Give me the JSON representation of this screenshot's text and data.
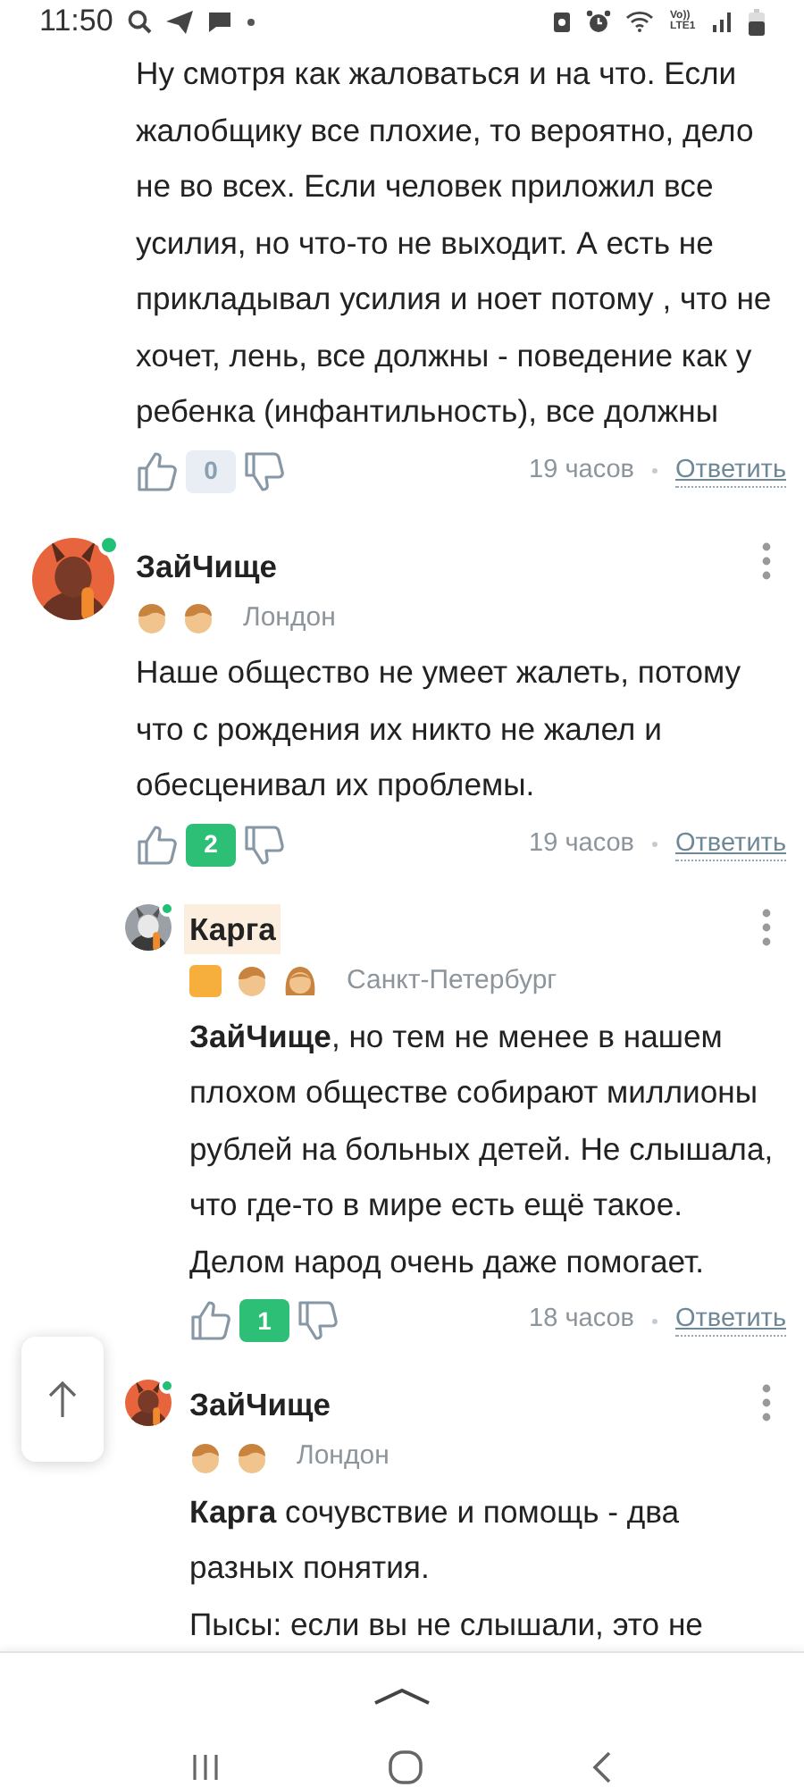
{
  "status_bar": {
    "time": "11:50",
    "network_label": "Vo)) LTE1"
  },
  "comments": [
    {
      "paragraphs": [
        "Ну смотря как жаловаться и на что. Если жалобщику все плохие, то вероятно, дело не во всех. Если человек приложил все усилия, но что-то не выходит. А есть не прикладывал усилия и ноет потому , что не хочет, лень, все должны - поведение как у ребенка (инфантильность), все должны"
      ],
      "votes": "0",
      "votes_highlighted": false,
      "time": "19 часов",
      "reply": "Ответить"
    },
    {
      "author": "ЗайЧище",
      "online": true,
      "name_highlighted": false,
      "badges": [
        {
          "kind": "boy"
        },
        {
          "kind": "boy"
        }
      ],
      "location": "Лондон",
      "paragraphs": [
        "Наше общество не умеет жалеть, потому что с рождения их никто не жалел и обесценивал их проблемы."
      ],
      "votes": "2",
      "votes_highlighted": true,
      "time": "19 часов",
      "reply": "Ответить",
      "children": [
        {
          "author": "Карга",
          "online": true,
          "name_highlighted": true,
          "badges": [
            {
              "kind": "square"
            },
            {
              "kind": "boy"
            },
            {
              "kind": "girl"
            }
          ],
          "location": "Санкт-Петербург",
          "paragraphs": [
            "**ЗайЧище**, но тем не менее в нашем плохом обществе собирают миллионы рублей на больных детей. Не слышала, что где-то в мире есть ещё такое. Делом народ очень даже помогает."
          ],
          "votes": "1",
          "votes_highlighted": true,
          "time": "18 часов",
          "reply": "Ответить"
        },
        {
          "author": "ЗайЧище",
          "online": true,
          "name_highlighted": false,
          "badges": [
            {
              "kind": "boy"
            },
            {
              "kind": "boy"
            }
          ],
          "location": "Лондон",
          "paragraphs": [
            "**Карга** сочувствие и помощь - два разных понятия.",
            "Пысы: если вы не слышали, это не"
          ]
        }
      ]
    }
  ]
}
